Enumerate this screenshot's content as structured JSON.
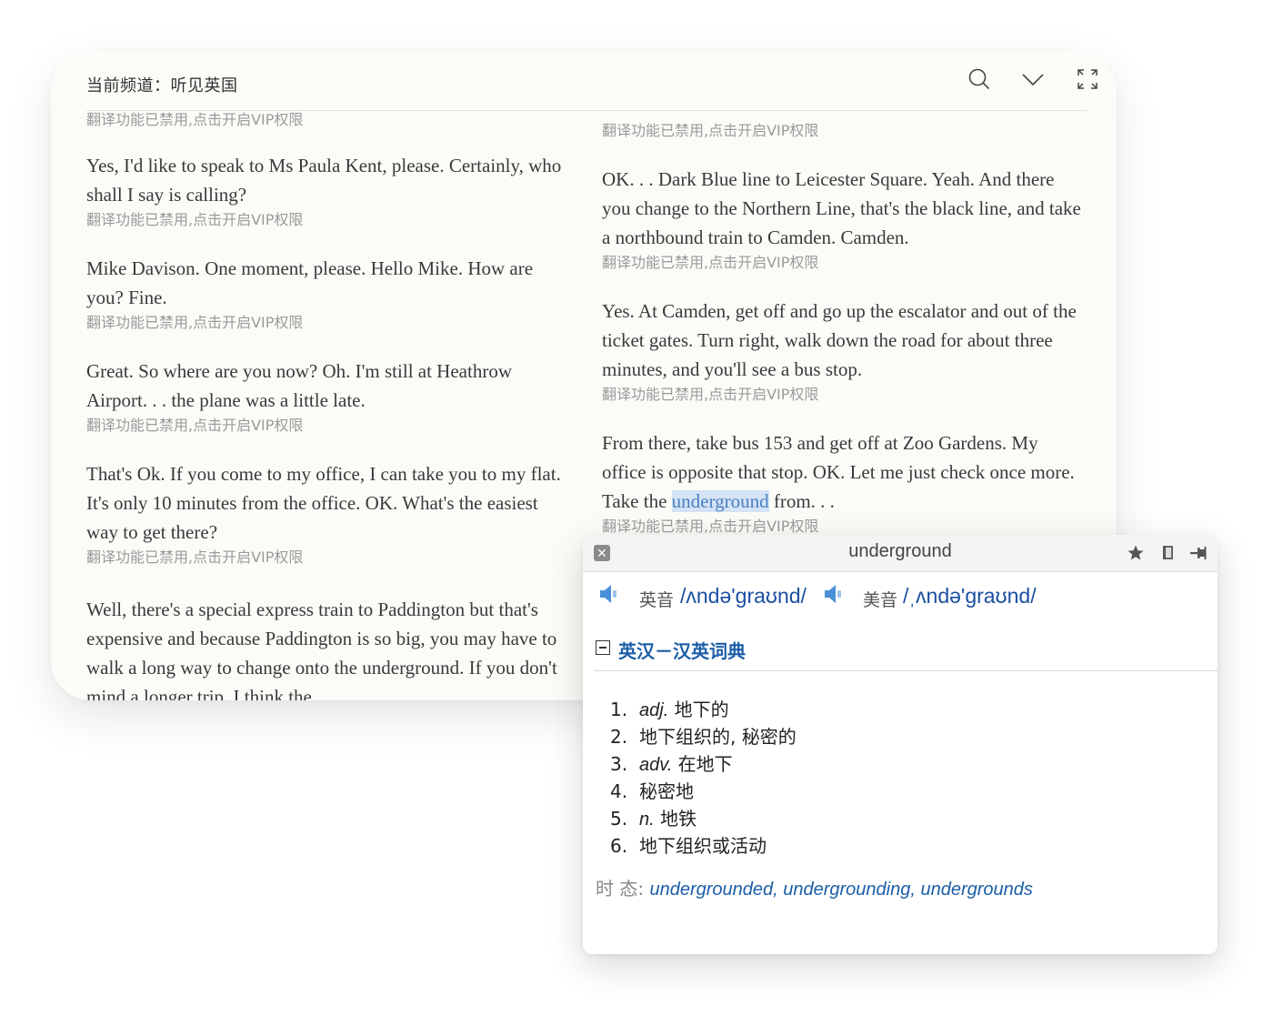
{
  "reader": {
    "channel_label": "当前频道：听见英国",
    "icons": [
      "search-icon",
      "chevron-down-icon",
      "expand-icon"
    ],
    "translation_notice": "翻译功能已禁用,点击开启VIP权限",
    "left_column": [
      {
        "text": "",
        "translation": "翻译功能已禁用,点击开启VIP权限"
      },
      {
        "text": "Yes, I'd like to speak to Ms Paula Kent, please. Certainly, who shall I say is calling?",
        "translation": "翻译功能已禁用,点击开启VIP权限"
      },
      {
        "text": "Mike Davison. One moment, please. Hello Mike. How are you? Fine.",
        "translation": "翻译功能已禁用,点击开启VIP权限"
      },
      {
        "text": "Great. So where are you now? Oh. I'm still at Heathrow Airport. . . the plane was a little late.",
        "translation": "翻译功能已禁用,点击开启VIP权限"
      },
      {
        "text": "That's Ok. If you come to my office, I can take you to my flat. It's only 10 minutes from the office. OK. What's the easiest way to get there?",
        "translation": "翻译功能已禁用,点击开启VIP权限"
      },
      {
        "text": "Well, there's a special express train to Paddington but that's expensive and because Paddington is so big, you may have to walk a long way to change onto the underground. If you don't mind a longer trip, I think the",
        "translation": ""
      }
    ],
    "right_column": [
      {
        "text": "",
        "translation": "翻译功能已禁用,点击开启VIP权限"
      },
      {
        "text": "OK. . . Dark Blue line to Leicester Square. Yeah. And there you change to the Northern Line, that's the black line, and take a northbound train to Camden. Camden.",
        "translation": "翻译功能已禁用,点击开启VIP权限"
      },
      {
        "text": "Yes. At Camden, get off and go up the escalator and out of the ticket gates. Turn right, walk down the road for about three minutes, and you'll see a bus stop.",
        "translation": "翻译功能已禁用,点击开启VIP权限"
      },
      {
        "text_before": "From there, take bus 153 and get off at Zoo Gardens. My office is opposite that stop. OK. Let me just check once more. Take the ",
        "highlight": "underground",
        "text_after": " from. . .",
        "translation": "翻译功能已禁用,点击开启VIP权限"
      }
    ]
  },
  "dictionary": {
    "word": "underground",
    "toolbar_icons": [
      "close-icon",
      "star-icon",
      "book-icon",
      "pin-icon"
    ],
    "uk_label": "英音",
    "uk_phonetic": "/ʌndə'graʊnd/",
    "us_label": "美音",
    "us_phonetic": "/ˌʌndə'graʊnd/",
    "section_title": "英汉－汉英词典",
    "definitions": [
      {
        "num": "1.",
        "pos": "adj.",
        "meaning": " 地下的"
      },
      {
        "num": "2.",
        "pos": "",
        "meaning": "地下组织的, 秘密的"
      },
      {
        "num": "3.",
        "pos": "adv.",
        "meaning": " 在地下"
      },
      {
        "num": "4.",
        "pos": "",
        "meaning": "秘密地"
      },
      {
        "num": "5.",
        "pos": "n.",
        "meaning": " 地铁"
      },
      {
        "num": "6.",
        "pos": "",
        "meaning": "地下组织或活动"
      }
    ],
    "tense_label": "时 态: ",
    "tense_forms": "undergrounded, undergrounding, undergrounds",
    "colors": {
      "accent": "#1c5ea8",
      "highlight": "#d4e3f6",
      "speaker": "#4a90d9"
    }
  }
}
